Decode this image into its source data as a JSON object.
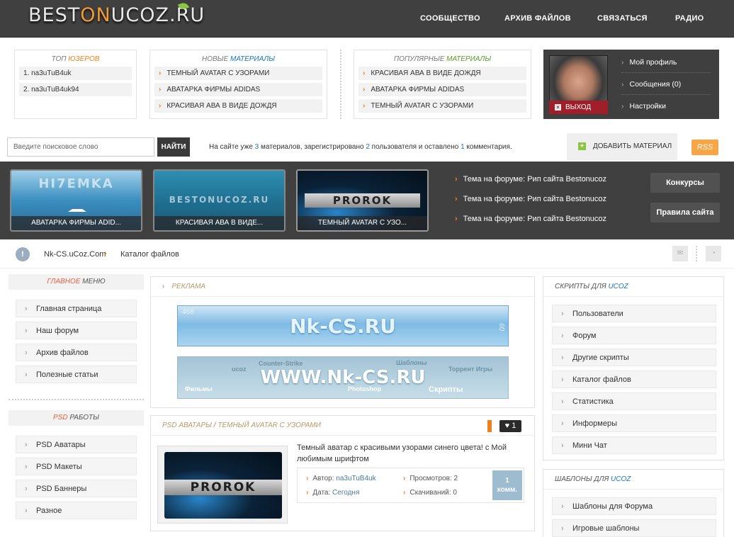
{
  "header": {
    "logo": {
      "part1": "BEST",
      "part2": "ON",
      "part3": "UCOZ.RU"
    },
    "nav": [
      "СООБЩЕСТВО",
      "АРХИВ ФАЙЛОВ",
      "СВЯЗАТЬСЯ",
      "РАДИО"
    ]
  },
  "top_users": {
    "title_plain": "ТОП ",
    "title_accent": "ЮЗЕРОВ",
    "items": [
      "1. na3uTuB4uk",
      "2. na3uTuB4uk94"
    ]
  },
  "new_materials": {
    "title_plain": "НОВЫЕ ",
    "title_accent": "МАТЕРИАЛЫ",
    "items": [
      "ТЕМНЫЙ AVATAR С УЗОРАМИ",
      "АВАТАРКА ФИРМЫ ADIDAS",
      "КРАСИВАЯ АВА В ВИДЕ ДОЖДЯ"
    ]
  },
  "popular_materials": {
    "title_plain": "ПОПУЛЯРНЫЕ ",
    "title_accent": "МАТЕРИАЛЫ",
    "items": [
      "КРАСИВАЯ АВА В ВИДЕ ДОЖДЯ",
      "АВАТАРКА ФИРМЫ ADIDAS",
      "ТЕМНЫЙ AVATAR С УЗОРАМИ"
    ]
  },
  "user_panel": {
    "logout": "ВЫХОД",
    "menu": [
      "Мой профиль",
      "Сообщения (0)",
      "Настройки"
    ]
  },
  "search": {
    "placeholder": "Введите поисковое слово",
    "button": "НАЙТИ"
  },
  "site_stats": {
    "p1": "На сайте уже ",
    "materials": "3",
    "p2": " материалов, зарегистрировано ",
    "users": "2",
    "p3": " пользователя и оставлено ",
    "comments": "1",
    "p4": " комментария."
  },
  "add_material": "ДОБАВИТЬ МАТЕРИАЛ",
  "rss": "RSS",
  "slider": {
    "thumbs": [
      {
        "big": "HI7EMKA",
        "caption": "АВАТАРКА ФИРМЫ ADID..."
      },
      {
        "big": "BESTONUCOZ.RU",
        "caption": "КРАСИВАЯ АВА В ВИДЕ..."
      },
      {
        "big": "PROROK",
        "caption": "ТЕМНЫЙ AVATAR С УЗО..."
      }
    ],
    "forum_links": [
      "Тема на форуме: Рип сайта Bestonucoz",
      "Тема на форуме: Рип сайта Bestonucoz",
      "Тема на форуме: Рип сайта Bestonucoz"
    ],
    "buttons": [
      "Конкурсы",
      "Правила сайта"
    ]
  },
  "breadcrumb": {
    "icon": "!",
    "items": [
      "Nk-CS.uCoz.Com",
      "Каталог файлов"
    ]
  },
  "main_menu": {
    "title_accent": "ГЛАВНОЕ",
    "title_plain": " МЕНЮ",
    "items": [
      "Главная страница",
      "Наш форум",
      "Архив файлов",
      "Полезные статьи"
    ]
  },
  "psd_menu": {
    "title_accent": "PSD",
    "title_plain": " РАБОТЫ",
    "items": [
      "PSD Аватары",
      "PSD Макеты",
      "PSD Баннеры",
      "Разное"
    ]
  },
  "ads": {
    "title": "РЕКЛАМА",
    "banner1": {
      "text": "Nk-CS.RU",
      "w": "468",
      "h": "60"
    },
    "banner2": {
      "text": "WWW.Nk-CS.RU",
      "words": [
        "Counter-Strike",
        "ucoz",
        "Шаблоны",
        "Торрент Игры",
        "Фильмы",
        "Photoshop",
        "Скрипты"
      ]
    }
  },
  "entry": {
    "category": "PSD АВАТАРЫ",
    "sep": "/",
    "title": "ТЕМНЫЙ AVATAR С УЗОРАМИ",
    "likes": "1",
    "thumb_text": "PROROK",
    "description": "Темный аватар с красивыми узорами синего цвета! с Мой любимым шрифтом",
    "author_label": "Автор:",
    "author": "na3uTuB4uk",
    "date_label": "Дата:",
    "date": "Сегодня",
    "views_label": "Просмотров:",
    "views": "2",
    "downloads_label": "Скачиваний:",
    "downloads": "0",
    "comments_count": "1",
    "comments_label": "комм."
  },
  "scripts_box": {
    "title_plain": "СКРИПТЫ ДЛЯ ",
    "title_accent": "UCOZ",
    "items": [
      "Пользователи",
      "Форум",
      "Другие скрипты",
      "Каталог файлов",
      "Статистика",
      "Информеры",
      "Мини Чат"
    ]
  },
  "templates_box": {
    "title_plain": "ШАБЛОНЫ ДЛЯ ",
    "title_accent": "UCOZ",
    "items": [
      "Шаблоны для Форума",
      "Игровые шаблоны"
    ]
  },
  "colors": {
    "accent_orange": "#f0801a",
    "accent_red": "#e8603c",
    "link_blue": "#1a75bb",
    "dark": "#404040"
  }
}
